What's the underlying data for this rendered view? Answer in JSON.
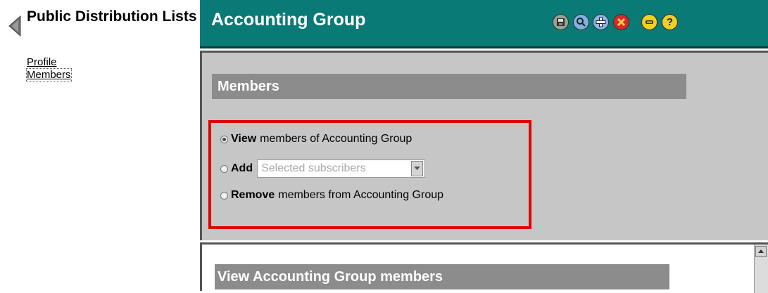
{
  "nav": {
    "title": "Public Distribution Lists",
    "links": [
      "Profile",
      "Members"
    ]
  },
  "header": {
    "title": "Accounting Group",
    "toolbar_icons": [
      "save-icon",
      "search-icon",
      "add-icon",
      "delete-icon",
      "subscriber-icon",
      "help-icon"
    ]
  },
  "members": {
    "section_title": "Members",
    "options": {
      "view": {
        "bold": "View",
        "text": "members of Accounting Group",
        "checked": true
      },
      "add": {
        "bold": "Add",
        "select_value": "Selected subscribers",
        "checked": false
      },
      "remove": {
        "bold": "Remove",
        "text": "members from Accounting Group",
        "checked": false
      }
    }
  },
  "bottom": {
    "section_title": "View Accounting Group members"
  },
  "colors": {
    "header_bg": "#097a76",
    "panel_bg": "#c6c6c6",
    "section_bar": "#8c8c8c",
    "highlight_border": "#e00000"
  }
}
